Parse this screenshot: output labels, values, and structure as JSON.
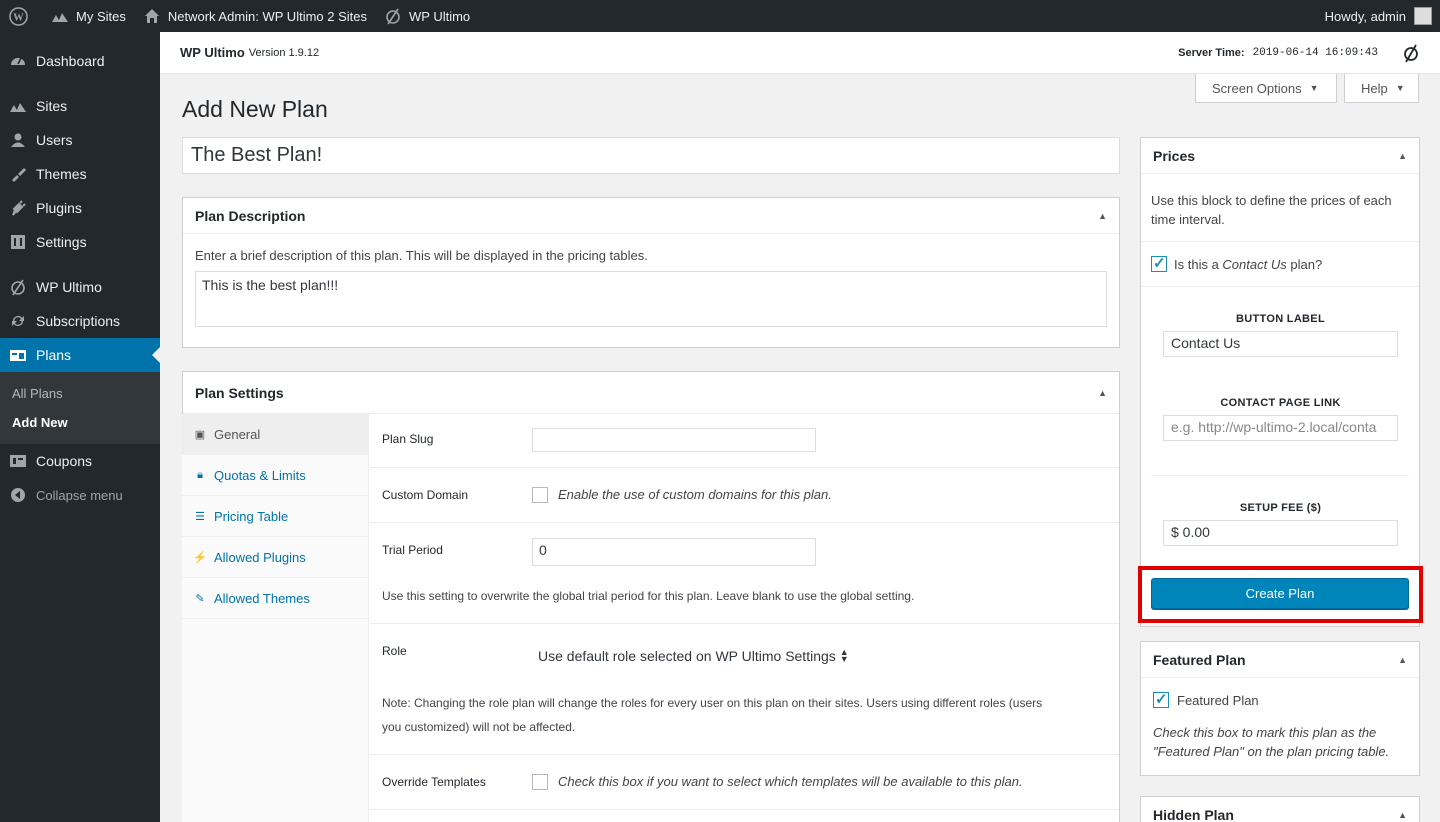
{
  "adminbar": {
    "my_sites": "My Sites",
    "network_admin": "Network Admin: WP Ultimo 2 Sites",
    "wp_ultimo": "WP Ultimo",
    "howdy": "Howdy, admin"
  },
  "sidebar": {
    "items": [
      {
        "label": "Dashboard",
        "icon": "dashboard-icon"
      },
      {
        "label": "Sites",
        "icon": "sites-icon"
      },
      {
        "label": "Users",
        "icon": "users-icon"
      },
      {
        "label": "Themes",
        "icon": "themes-icon"
      },
      {
        "label": "Plugins",
        "icon": "plugins-icon"
      },
      {
        "label": "Settings",
        "icon": "settings-icon"
      },
      {
        "label": "WP Ultimo",
        "icon": "wp-ultimo-icon"
      },
      {
        "label": "Subscriptions",
        "icon": "subscriptions-icon"
      },
      {
        "label": "Plans",
        "icon": "plans-icon"
      },
      {
        "label": "Coupons",
        "icon": "coupons-icon"
      },
      {
        "label": "Collapse menu",
        "icon": "collapse-icon"
      }
    ],
    "submenu": [
      "All Plans",
      "Add New"
    ]
  },
  "header": {
    "brand": "WP Ultimo",
    "version": "Version 1.9.12",
    "server_time_label": "Server Time:",
    "server_time": "2019-06-14 16:09:43"
  },
  "screen_options": "Screen Options",
  "help": "Help",
  "page_title": "Add New Plan",
  "plan_title": "The Best Plan!",
  "description": {
    "heading": "Plan Description",
    "help": "Enter a brief description of this plan. This will be displayed in the pricing tables.",
    "value": "This is the best plan!!!"
  },
  "settings": {
    "heading": "Plan Settings",
    "tabs": [
      "General",
      "Quotas & Limits",
      "Pricing Table",
      "Allowed Plugins",
      "Allowed Themes"
    ],
    "plan_slug_label": "Plan Slug",
    "plan_slug_value": "",
    "custom_domain_label": "Custom Domain",
    "custom_domain_text": "Enable the use of custom domains for this plan.",
    "trial_label": "Trial Period",
    "trial_value": "0",
    "trial_note": "Use this setting to overwrite the global trial period for this plan. Leave blank to use the global setting.",
    "role_label": "Role",
    "role_value": "Use default role selected on WP Ultimo Settings",
    "role_note_1": "Note: Changing the role plan will change the roles for every user on this plan on their sites. Users using different roles (users",
    "role_note_2": "you customized) will not be affected.",
    "override_label": "Override Templates",
    "override_text": "Check this box if you want to select which templates will be available to this plan."
  },
  "prices": {
    "heading": "Prices",
    "help_1": "Use this block to define the prices of each",
    "help_2": "time interval.",
    "contact_prefix": "Is this a",
    "contact_em": "Contact Us",
    "contact_suffix": "plan?",
    "button_label_title": "BUTTON LABEL",
    "button_label_value": "Contact Us",
    "contact_link_title": "CONTACT PAGE LINK",
    "contact_link_placeholder": "e.g. http://wp-ultimo-2.local/conta",
    "setup_fee_title": "SETUP FEE ($)",
    "setup_fee_value": "$ 0.00",
    "create_button": "Create Plan"
  },
  "featured": {
    "heading": "Featured Plan",
    "checkbox_label": "Featured Plan",
    "help_1": "Check this box to mark this plan as the",
    "help_2": "\"Featured Plan\" on the plan pricing table."
  },
  "hidden": {
    "heading": "Hidden Plan"
  }
}
